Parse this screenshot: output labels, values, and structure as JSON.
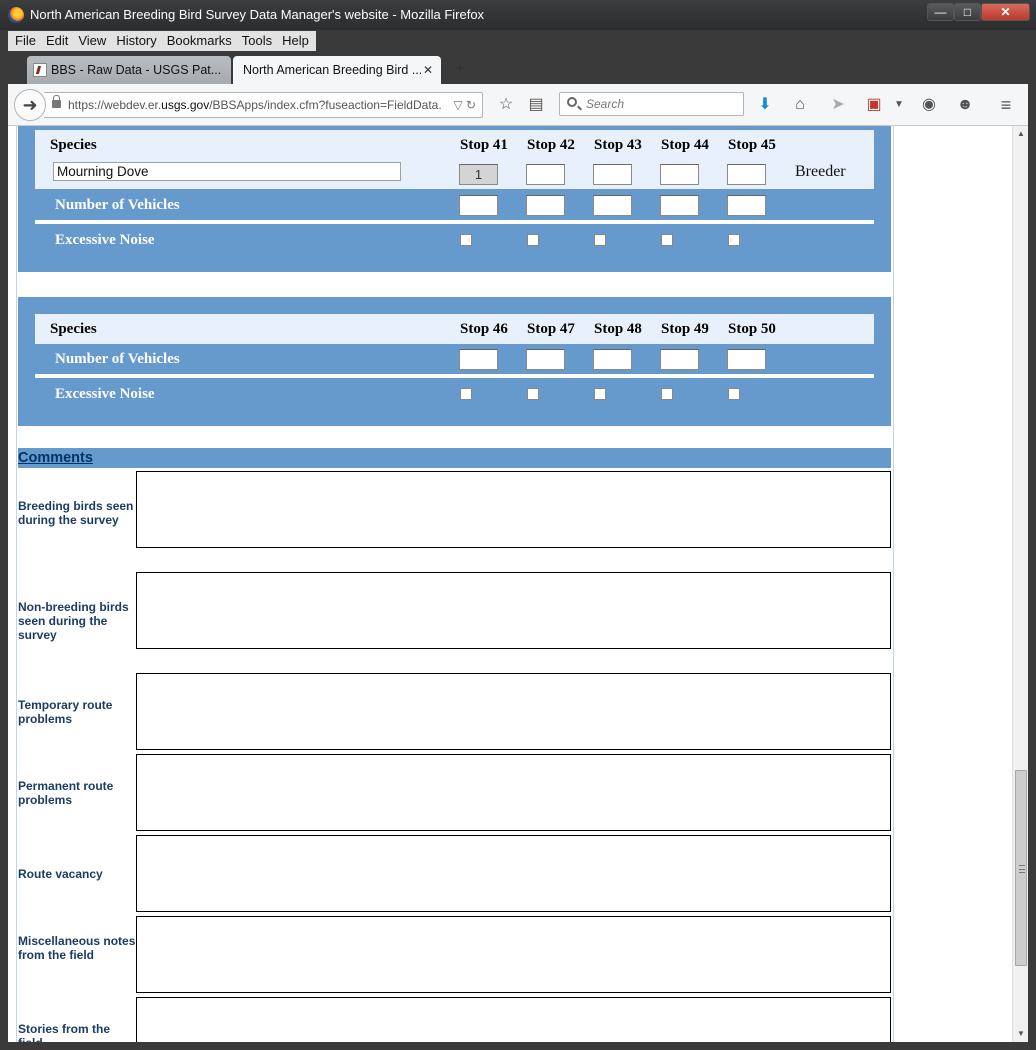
{
  "window": {
    "title": "North American Breeding Bird Survey Data Manager's website - Mozilla Firefox",
    "min_label": "—",
    "max_label": "□",
    "close_label": "✕"
  },
  "menu": [
    {
      "label": "File"
    },
    {
      "label": "Edit"
    },
    {
      "label": "View"
    },
    {
      "label": "History"
    },
    {
      "label": "Bookmarks"
    },
    {
      "label": "Tools"
    },
    {
      "label": "Help"
    }
  ],
  "tabs": [
    {
      "label": "BBS - Raw Data - USGS Pat...",
      "active": false,
      "close": "✕"
    },
    {
      "label": "North American Breeding Bird ...",
      "active": true,
      "close": "✕"
    }
  ],
  "new_tab_label": "+",
  "urlbar": {
    "prefix": "https://webdev.er.",
    "domain": "usgs.gov",
    "suffix": "/BBSApps/index.cfm?fuseaction=FieldData.",
    "end_glyphs": "▽ ↻"
  },
  "search": {
    "placeholder": "Search"
  },
  "toolbar_icons": [
    "star-icon",
    "reader-list-icon",
    "download-icon",
    "home-icon",
    "send-icon",
    "pdf-icon",
    "history-icon",
    "smiley-icon",
    "hamburger-menu-icon"
  ],
  "block1": {
    "species_header": "Species",
    "stops": [
      "Stop 41",
      "Stop 42",
      "Stop 43",
      "Stop 44",
      "Stop 45"
    ],
    "species_value": "Mourning Dove",
    "counts": [
      "1",
      "",
      "",
      "",
      ""
    ],
    "breeder_label": "Breeder",
    "vehicles_label": "Number of Vehicles",
    "noise_label": "Excessive Noise"
  },
  "block2": {
    "species_header": "Species",
    "stops": [
      "Stop 46",
      "Stop 47",
      "Stop 48",
      "Stop 49",
      "Stop 50"
    ],
    "vehicles_label": "Number of Vehicles",
    "noise_label": "Excessive Noise"
  },
  "comments": {
    "heading": "Comments",
    "fields": [
      {
        "label": "Breeding birds seen during the survey"
      },
      {
        "label": "Non-breeding birds seen during the survey"
      },
      {
        "label": "Temporary route problems"
      },
      {
        "label": "Permanent route problems"
      },
      {
        "label": "Route vacancy"
      },
      {
        "label": "Miscellaneous notes from the field"
      },
      {
        "label": "Stories from the field"
      }
    ]
  },
  "colors": {
    "block_blue": "#6699cc",
    "header_light": "#e8f1fb",
    "comment_label": "#1c3c63"
  }
}
